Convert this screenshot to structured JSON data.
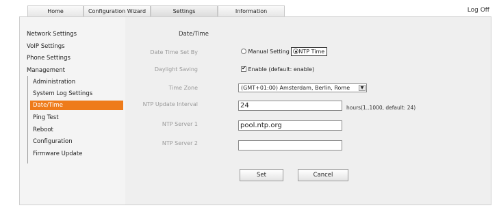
{
  "tabs": [
    {
      "label": "Home",
      "active": false
    },
    {
      "label": "Configuration Wizard",
      "active": false
    },
    {
      "label": "Settings",
      "active": true
    },
    {
      "label": "Information",
      "active": false
    }
  ],
  "header": {
    "logoff_label": "Log Off"
  },
  "sidebar": {
    "items": [
      {
        "label": "Network Settings"
      },
      {
        "label": "VoIP Settings"
      },
      {
        "label": "Phone Settings"
      },
      {
        "label": "Management"
      }
    ],
    "subitems": [
      {
        "label": "Administration"
      },
      {
        "label": "System Log Settings"
      },
      {
        "label": "Date/Time",
        "selected": true
      },
      {
        "label": "Ping Test"
      },
      {
        "label": "Reboot"
      },
      {
        "label": "Configuration"
      },
      {
        "label": "Firmware Update"
      }
    ]
  },
  "page": {
    "title": "Date/Time"
  },
  "form": {
    "date_time_set_by": {
      "label": "Date Time Set By",
      "options": [
        "Manual Setting",
        "NTP Time"
      ],
      "selected": "NTP Time"
    },
    "daylight_saving": {
      "label": "Daylight Saving",
      "option_label": "Enable (default: enable)",
      "checked": true
    },
    "time_zone": {
      "label": "Time Zone",
      "value": "(GMT+01:00) Amsterdam, Berlin, Rome"
    },
    "ntp_update_interval": {
      "label": "NTP Update Interval",
      "value": "24",
      "hint": "hours(1..1000, default: 24)"
    },
    "ntp_server_1": {
      "label": "NTP Server 1",
      "value": "pool.ntp.org"
    },
    "ntp_server_2": {
      "label": "NTP Server 2",
      "value": ""
    }
  },
  "buttons": {
    "set_label": "Set",
    "cancel_label": "Cancel"
  },
  "colors": {
    "accent": "#ee7b1a",
    "panel_bg": "#efefef",
    "sidebar_bg": "#f4f4f4"
  },
  "icons": {
    "select_arrow": "chevron-down-icon",
    "radio": "radio-icon",
    "checkbox": "checkmark-icon"
  }
}
